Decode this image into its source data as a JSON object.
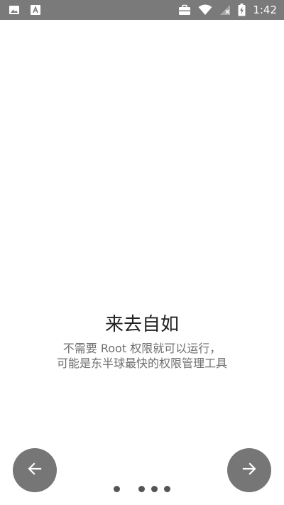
{
  "status_bar": {
    "time": "1:42",
    "left_icons": [
      "image-icon",
      "font-icon"
    ],
    "right_icons": [
      "briefcase-icon",
      "wifi-icon",
      "no-signal-icon",
      "battery-charging-icon"
    ],
    "background": "#7a7a7a"
  },
  "onboarding": {
    "title": "来去自如",
    "description_line1": "不需要 Root 权限就可以运行，",
    "description_line2": "可能是东半球最快的权限管理工具",
    "page_count": 4,
    "current_page": 1
  },
  "navigation": {
    "prev_icon": "arrow-left-icon",
    "next_icon": "arrow-right-icon",
    "button_color": "#767676"
  }
}
